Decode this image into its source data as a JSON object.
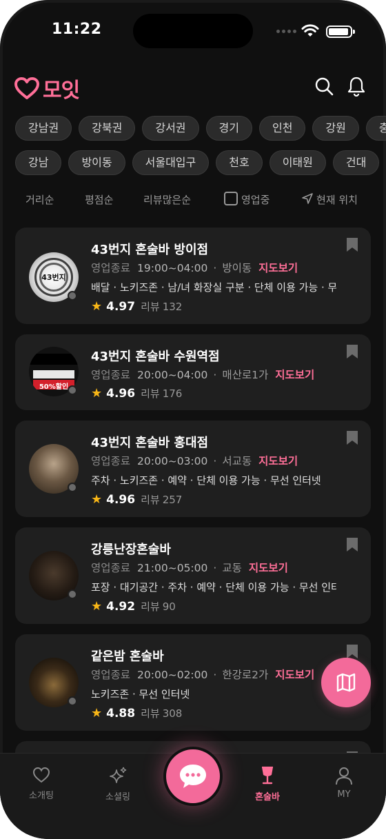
{
  "status_bar": {
    "time": "11:22"
  },
  "header": {
    "logo_text": "모잇"
  },
  "region_chips": [
    "강남권",
    "강북권",
    "강서권",
    "경기",
    "인천",
    "강원",
    "충청"
  ],
  "area_chips": [
    "강남",
    "방이동",
    "서울대입구",
    "천호",
    "이태원",
    "건대"
  ],
  "filters": {
    "distance": "거리순",
    "rating": "평점순",
    "reviews": "리뷰많은순",
    "open_now": "영업중",
    "location": "현재 위치"
  },
  "cards": [
    {
      "title": "43번지 혼술바 방이점",
      "status": "영업종료",
      "hours": "19:00~04:00",
      "area": "방이동",
      "map_link": "지도보기",
      "tags": "배달 · 노키즈존 · 남/녀 화장실 구분 · 단체 이용 가능 · 무선 인터넷",
      "score": "4.97",
      "review_label": "리뷰",
      "review_count": "132",
      "avatar_text": "43번지"
    },
    {
      "title": "43번지 혼술바 수원역점",
      "status": "영업종료",
      "hours": "20:00~04:00",
      "area": "매산로1가",
      "map_link": "지도보기",
      "tags": "",
      "score": "4.96",
      "review_label": "리뷰",
      "review_count": "176",
      "avatar_text": "50%할인"
    },
    {
      "title": "43번지 혼술바 홍대점",
      "status": "영업종료",
      "hours": "20:00~03:00",
      "area": "서교동",
      "map_link": "지도보기",
      "tags": "주차 · 노키즈존 · 예약 · 단체 이용 가능 · 무선 인터넷",
      "score": "4.96",
      "review_label": "리뷰",
      "review_count": "257",
      "avatar_text": ""
    },
    {
      "title": "강릉난장혼술바",
      "status": "영업종료",
      "hours": "21:00~05:00",
      "area": "교동",
      "map_link": "지도보기",
      "tags": "포장 · 대기공간 · 주차 · 예약 · 단체 이용 가능 · 무선 인터넷",
      "score": "4.92",
      "review_label": "리뷰",
      "review_count": "90",
      "avatar_text": ""
    },
    {
      "title": "같은밤 혼술바",
      "status": "영업종료",
      "hours": "20:00~02:00",
      "area": "한강로2가",
      "map_link": "지도보기",
      "tags": "노키즈존 · 무선 인터넷",
      "score": "4.88",
      "review_label": "리뷰",
      "review_count": "308",
      "avatar_text": ""
    }
  ],
  "bottom_nav": [
    {
      "label": "소개팅",
      "icon": "heart-icon"
    },
    {
      "label": "소셜링",
      "icon": "sparkle-icon"
    },
    {
      "label": "혼술바",
      "icon": "wine-glass-icon",
      "active": true
    },
    {
      "label": "MY",
      "icon": "person-icon"
    }
  ],
  "colors": {
    "accent": "#ff6f98",
    "background": "#101010",
    "card": "#1f1f1f",
    "star": "#f8b617"
  }
}
